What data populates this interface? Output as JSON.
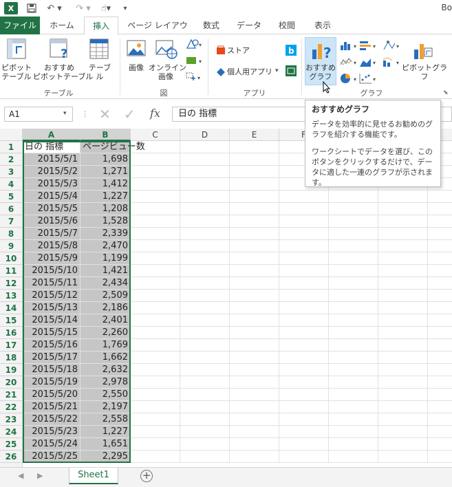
{
  "window": {
    "title": "Bo"
  },
  "qat": {
    "logo": "X",
    "save_icon": "save-icon",
    "undo_icon": "undo-icon",
    "redo_icon": "redo-icon",
    "touch_icon": "touch-mode-icon"
  },
  "tabs": [
    {
      "label": "ファイル"
    },
    {
      "label": "ホーム"
    },
    {
      "label": "挿入"
    },
    {
      "label": "ページ レイアウト"
    },
    {
      "label": "数式"
    },
    {
      "label": "データ"
    },
    {
      "label": "校閲"
    },
    {
      "label": "表示"
    }
  ],
  "ribbon": {
    "pivot_table": "ピボット\nテーブル",
    "recommended_pivot": "おすすめ\nピボットテーブル",
    "table": "テーブル",
    "group_table": "テーブル",
    "picture": "画像",
    "online_picture": "オンライン\n画像",
    "group_figure": "図",
    "store": "ストア",
    "personal_apps": "個人用アプリ",
    "group_apps": "アプリ",
    "recommended_charts": "おすすめ\nグラフ",
    "pivot_chart": "ピボットグラフ",
    "group_charts": "グラフ"
  },
  "formula_bar": {
    "name_box": "A1",
    "content": "日の 指標",
    "fx": "fx"
  },
  "columns": [
    "A",
    "B",
    "C",
    "D",
    "E",
    "F"
  ],
  "header_row": {
    "a": "日の 指標",
    "b": "ページビュー数"
  },
  "rows": [
    {
      "date": "2015/5/1",
      "views": "1,698"
    },
    {
      "date": "2015/5/2",
      "views": "1,271"
    },
    {
      "date": "2015/5/3",
      "views": "1,412"
    },
    {
      "date": "2015/5/4",
      "views": "1,227"
    },
    {
      "date": "2015/5/5",
      "views": "1,208"
    },
    {
      "date": "2015/5/6",
      "views": "1,528"
    },
    {
      "date": "2015/5/7",
      "views": "2,339"
    },
    {
      "date": "2015/5/8",
      "views": "2,470"
    },
    {
      "date": "2015/5/9",
      "views": "1,199"
    },
    {
      "date": "2015/5/10",
      "views": "1,421"
    },
    {
      "date": "2015/5/11",
      "views": "2,434"
    },
    {
      "date": "2015/5/12",
      "views": "2,509"
    },
    {
      "date": "2015/5/13",
      "views": "2,186"
    },
    {
      "date": "2015/5/14",
      "views": "2,401"
    },
    {
      "date": "2015/5/15",
      "views": "2,260"
    },
    {
      "date": "2015/5/16",
      "views": "1,769"
    },
    {
      "date": "2015/5/17",
      "views": "1,662"
    },
    {
      "date": "2015/5/18",
      "views": "2,632"
    },
    {
      "date": "2015/5/19",
      "views": "2,978"
    },
    {
      "date": "2015/5/20",
      "views": "2,550"
    },
    {
      "date": "2015/5/21",
      "views": "2,197"
    },
    {
      "date": "2015/5/22",
      "views": "2,558"
    },
    {
      "date": "2015/5/23",
      "views": "1,227"
    },
    {
      "date": "2015/5/24",
      "views": "1,651"
    },
    {
      "date": "2015/5/25",
      "views": "2,295"
    }
  ],
  "tooltip": {
    "title": "おすすめグラフ",
    "p1": "データを効率的に見せるお勧めのグラフを紹介する機能です。",
    "p2": "ワークシートでデータを選び、このボタンをクリックするだけで、データに適した一連のグラフが示されます。"
  },
  "sheets": [
    {
      "label": "Sheet1"
    }
  ],
  "colors": {
    "accent": "#217346"
  }
}
